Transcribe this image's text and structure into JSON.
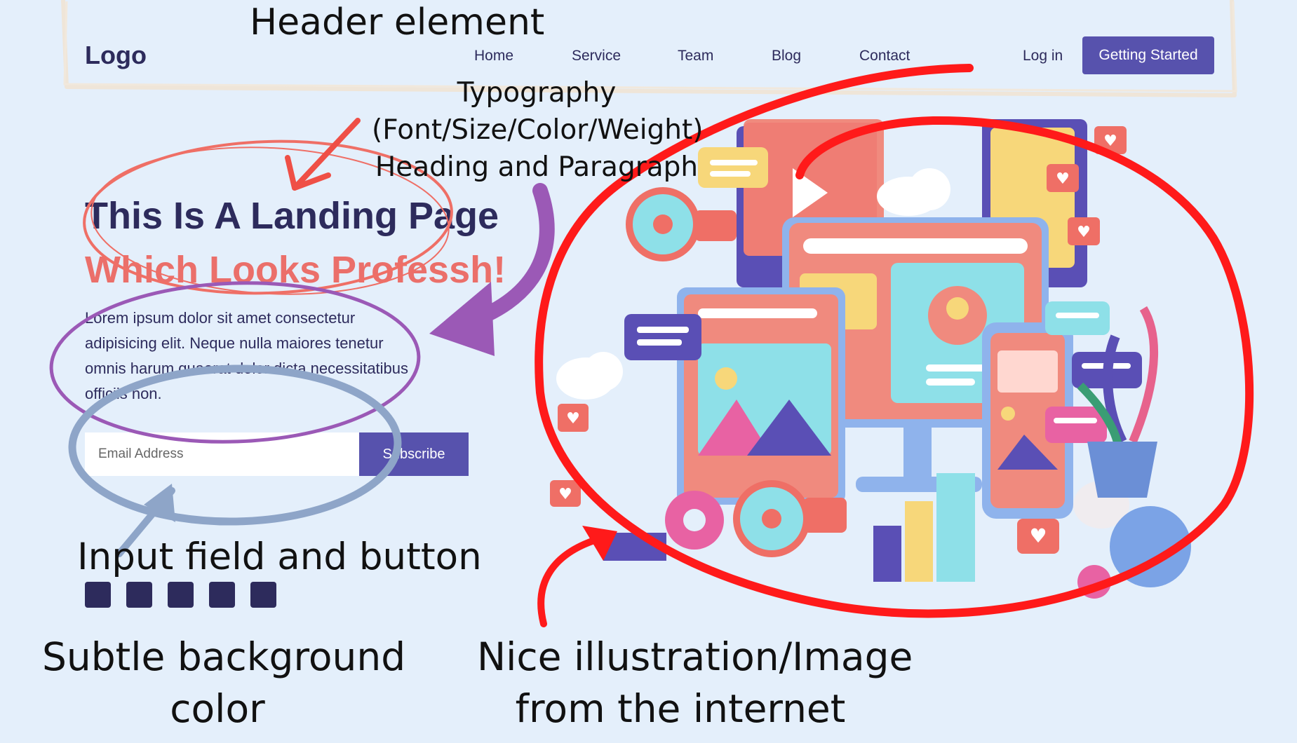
{
  "header": {
    "logo": "Logo",
    "nav": [
      "Home",
      "Service",
      "Team",
      "Blog",
      "Contact"
    ],
    "login": "Log in",
    "cta": "Getting Started"
  },
  "hero": {
    "title_line1": "This Is A Landing Page",
    "title_line2": "Which Looks Professh!",
    "paragraph": "Lorem ipsum dolor sit amet consectetur adipisicing elit. Neque nulla maiores tenetur omnis harum quaerat dolor dicta necessitatibus officiis non.",
    "email_placeholder": "Email Address",
    "subscribe": "Subscribe"
  },
  "annotations": {
    "header": "Header element",
    "typography": [
      "Typography",
      "(Font/Size/Color/Weight)",
      "Heading and Paragraph"
    ],
    "input": "Input field and button",
    "background": [
      "Subtle background",
      "color"
    ],
    "image": [
      "Nice illustration/Image",
      "from the internet"
    ]
  },
  "colors": {
    "background": "#e4effb",
    "primary": "#5752ad",
    "heading": "#2d2b5c",
    "accent": "#eb6f6a",
    "swatch": "#2d2b5c",
    "annotation_red": "#ff1a1a",
    "annotation_purple": "#9b59b6",
    "annotation_blue": "#8ea5c8"
  },
  "palette_swatches": 5
}
